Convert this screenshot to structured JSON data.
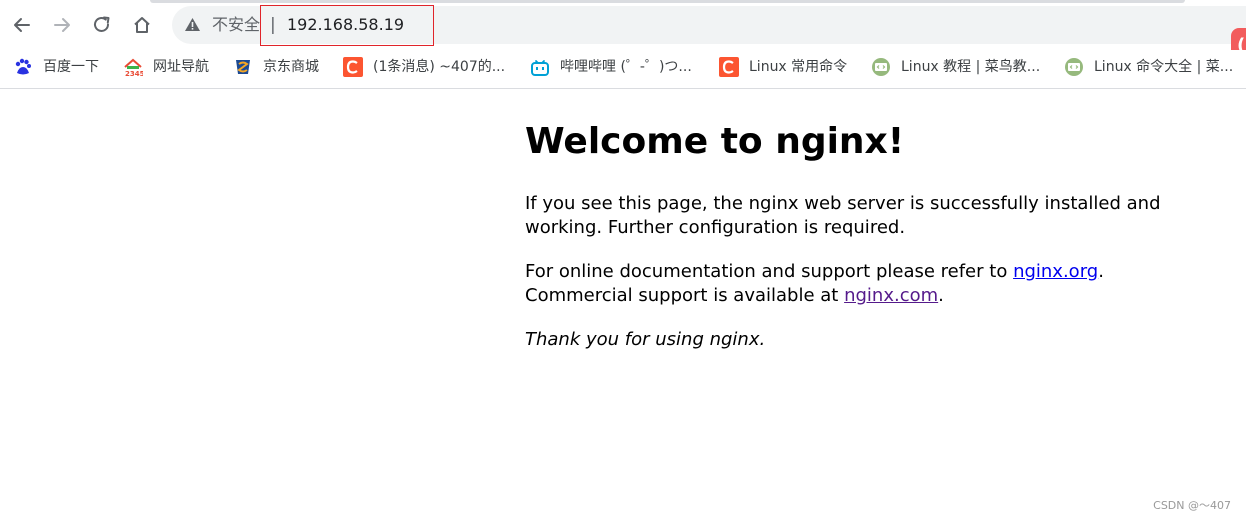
{
  "browser": {
    "nav": {
      "back_icon": "arrow-left-icon",
      "forward_icon": "arrow-right-icon",
      "reload_icon": "reload-icon",
      "home_icon": "home-icon"
    },
    "address": {
      "security_icon": "warning-triangle-icon",
      "insecure_label": "不安全",
      "separator": "|",
      "url": "192.168.58.19"
    }
  },
  "bookmarks": [
    {
      "label": "百度一下",
      "icon": "baidu-icon",
      "color": "#2932e1"
    },
    {
      "label": "网址导航",
      "icon": "2345-icon",
      "color": "#e94b35"
    },
    {
      "label": "京东商城",
      "icon": "jd-icon",
      "color": "#1c4a93"
    },
    {
      "label": "(1条消息) ~407的...",
      "icon": "csdn-icon",
      "color": "#fc5531"
    },
    {
      "label": "哔哩哔哩 (゜-゜)つ...",
      "icon": "bilibili-icon",
      "color": "#00a1d6"
    },
    {
      "label": "Linux 常用命令",
      "icon": "csdn-icon",
      "color": "#fc5531"
    },
    {
      "label": "Linux 教程 | 菜鸟教...",
      "icon": "runoob-icon",
      "color": "#96b97d"
    },
    {
      "label": "Linux 命令大全 | 菜...",
      "icon": "runoob-icon",
      "color": "#96b97d"
    }
  ],
  "page": {
    "title": "Welcome to nginx!",
    "paragraph1": "If you see this page, the nginx web server is successfully installed and working. Further configuration is required.",
    "p2_line1_prefix": "For online documentation and support please refer to ",
    "p2_link1": "nginx.org",
    "p2_line1_suffix": ".",
    "p2_line2_prefix": "Commercial support is available at ",
    "p2_link2": "nginx.com",
    "p2_line2_suffix": ".",
    "paragraph3": "Thank you for using nginx."
  },
  "watermark": "CSDN @～407"
}
